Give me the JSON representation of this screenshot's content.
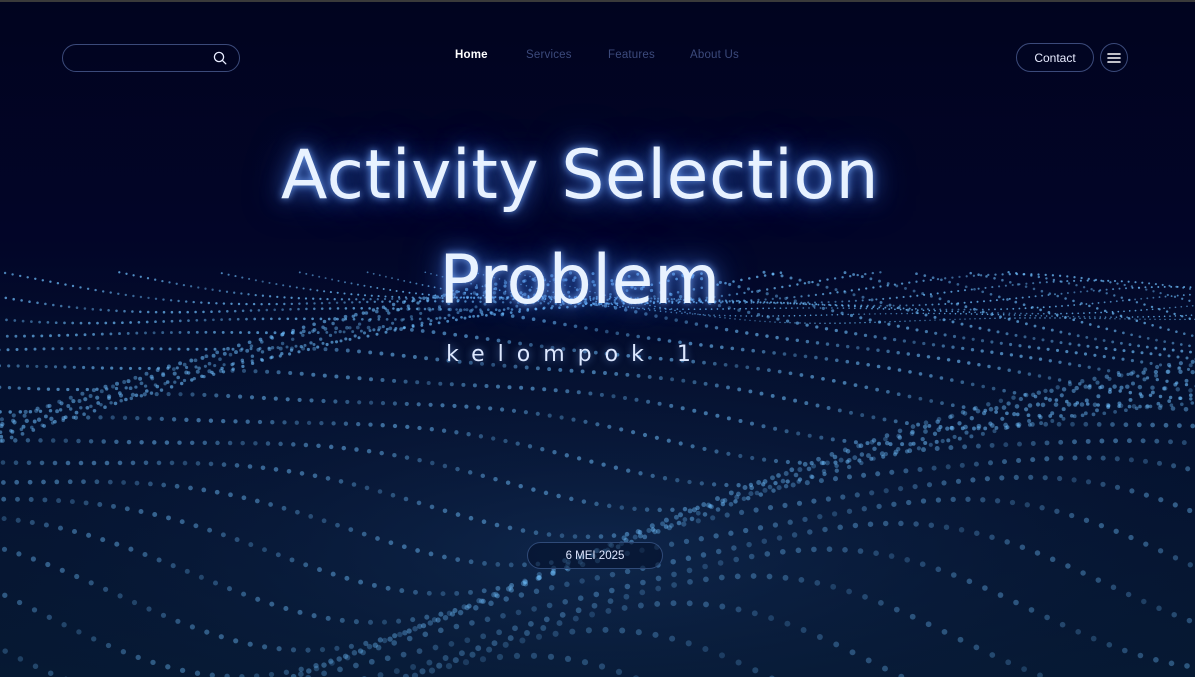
{
  "search": {
    "value": "",
    "placeholder": ""
  },
  "nav": {
    "items": [
      {
        "label": "Home",
        "active": true
      },
      {
        "label": "Services",
        "active": false
      },
      {
        "label": "Features",
        "active": false
      },
      {
        "label": "About Us",
        "active": false
      }
    ]
  },
  "header": {
    "contact_label": "Contact"
  },
  "hero": {
    "title_line1": "Activity Selection",
    "title_line2": "Problem",
    "subtitle": "kelompok 1",
    "date": "6 MEI 2025"
  },
  "colors": {
    "background": "#020424",
    "accent_glow": "#7fb0ff",
    "particle": "#6fc0ff",
    "nav_inactive": "#3c4a7c",
    "border": "#3b4a7a"
  },
  "icons": {
    "search": "search-icon",
    "menu": "hamburger-menu-icon"
  }
}
